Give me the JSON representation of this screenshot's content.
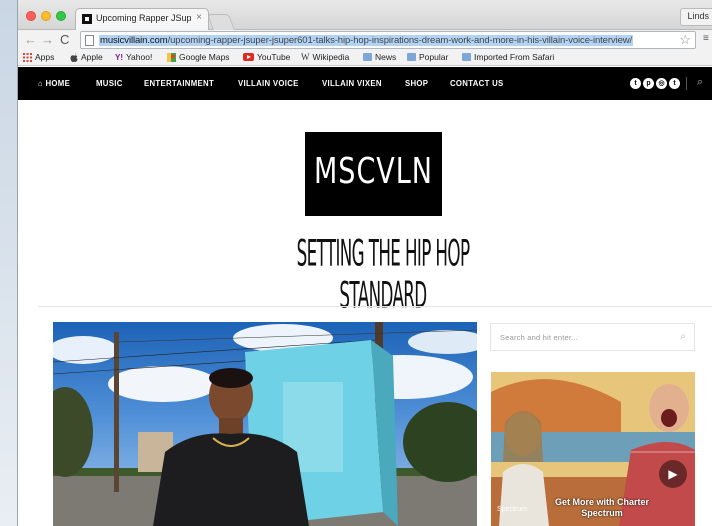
{
  "browser": {
    "tab_title": "Upcoming Rapper JSuper",
    "tab_close": "×",
    "user_name": "Linds",
    "url_domain": "musicvillain.com",
    "url_path": "/upcoming-rapper-jsuper-jsuper601-talks-hip-hop-inspirations-dream-work-and-more-in-his-villain-voice-interview/"
  },
  "bookmarks": [
    "Apps",
    "Apple",
    "Yahoo!",
    "Google Maps",
    "YouTube",
    "Wikipedia",
    "News",
    "Popular",
    "Imported From Safari"
  ],
  "site_nav": {
    "items": [
      "HOME",
      "MUSIC",
      "ENTERTAINMENT",
      "VILLAIN VOICE",
      "VILLAIN VIXEN",
      "SHOP",
      "CONTACT US"
    ]
  },
  "brand": {
    "logo": "MSCVLN",
    "tagline": "SETTING THE HIP HOP STANDARD"
  },
  "sidebar": {
    "search_placeholder": "Search and hit enter...",
    "ad_caption": "Get More with Charter Spectrum",
    "ad_brand": "Spectrum"
  },
  "colors": {
    "nav_bg": "#000000",
    "url_highlight": "#b3d3f5",
    "logo_bg": "#000000"
  }
}
